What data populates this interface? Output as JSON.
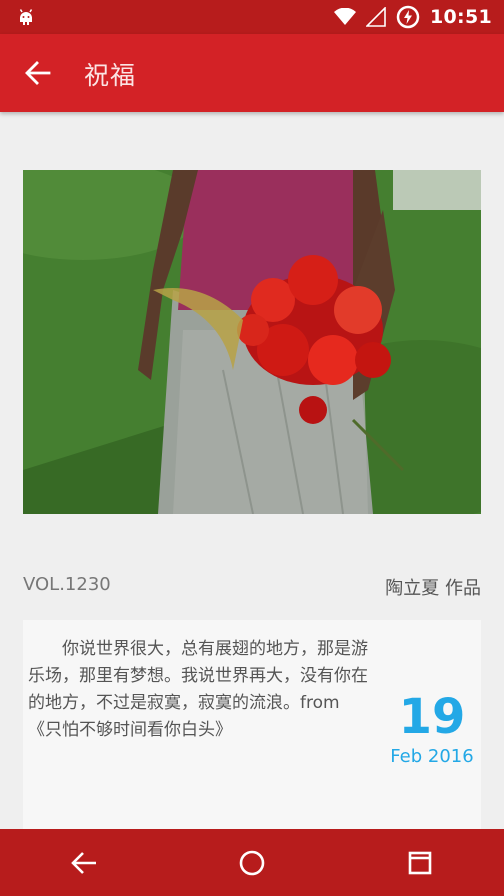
{
  "status_bar": {
    "time": "10:51",
    "icons": [
      "android-notification-icon",
      "wifi-icon",
      "signal-icon",
      "battery-charging-icon"
    ]
  },
  "app_bar": {
    "title": "祝福",
    "back_icon": "arrow-back-icon"
  },
  "article": {
    "volume": "VOL.1230",
    "author": "陶立夏 作品",
    "quote": "你说世界很大，总有展翅的地方，那是游乐场，那里有梦想。我说世界再大，没有你在的地方，不过是寂寞，寂寞的流浪。from 《只怕不够时间看你白头》",
    "date_day": "19",
    "date_month_year": "Feb 2016"
  },
  "nav_bar": {
    "icons": [
      "back-nav-icon",
      "home-nav-icon",
      "recents-nav-icon"
    ]
  },
  "colors": {
    "app_bar": "#d32226",
    "status_bar": "#b71c1c",
    "date_accent": "#23a8e6",
    "background": "#efefef"
  }
}
